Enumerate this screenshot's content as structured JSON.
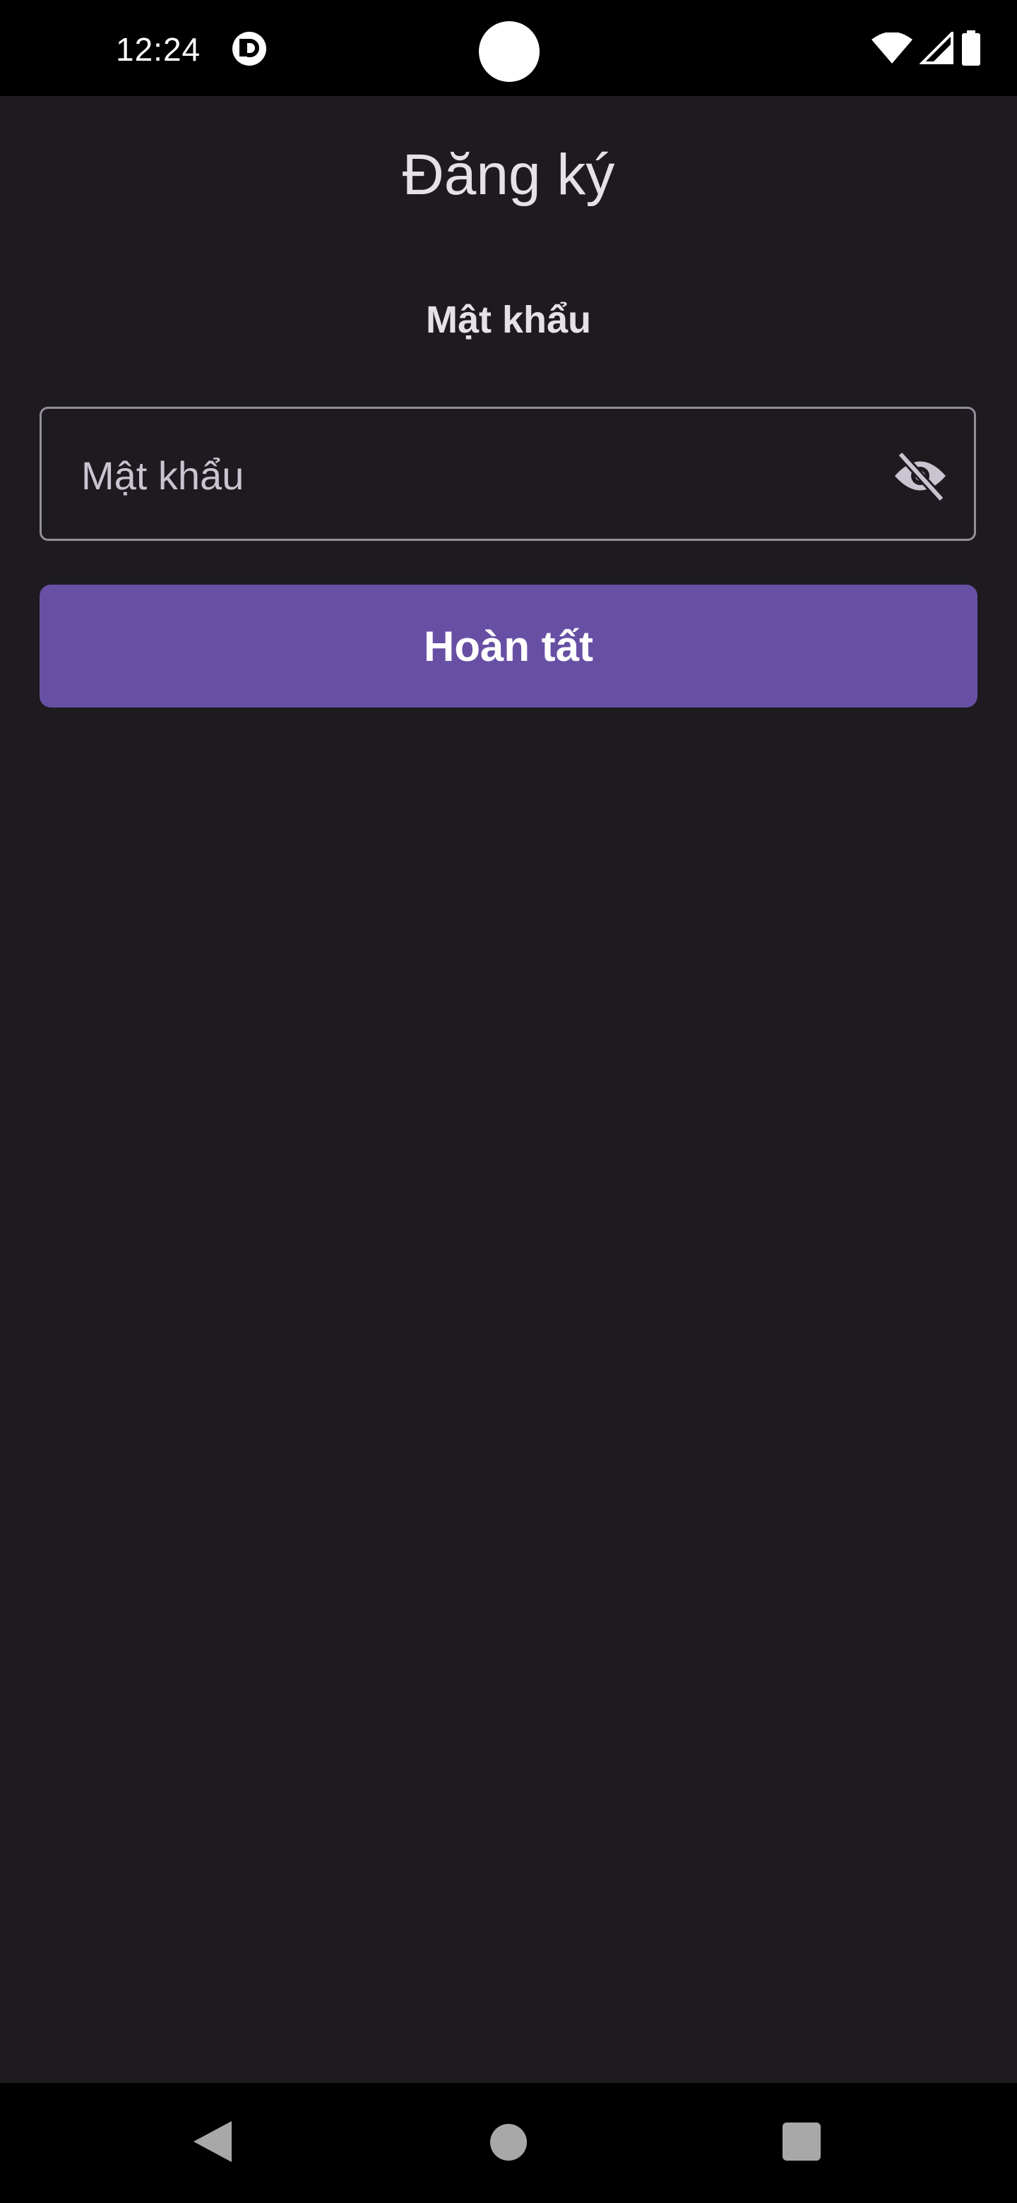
{
  "status_bar": {
    "time": "12:24",
    "app_icon": "pocket-cast-icon",
    "wifi_icon": "wifi-icon",
    "signal_icon": "cell-signal-icon",
    "battery_icon": "battery-icon"
  },
  "header": {
    "title": "Đăng ký"
  },
  "form": {
    "section_label": "Mật khẩu",
    "password": {
      "value": "",
      "placeholder": "Mật khẩu",
      "visibility_icon": "eye-off-icon"
    },
    "submit_label": "Hoàn tất"
  },
  "nav_bar": {
    "back_icon": "back-triangle-icon",
    "home_icon": "home-circle-icon",
    "recents_icon": "recents-square-icon"
  },
  "colors": {
    "background": "#1d1b20",
    "primary": "#6750a4",
    "outline": "#938f99",
    "on_surface": "#e6e1e5"
  }
}
